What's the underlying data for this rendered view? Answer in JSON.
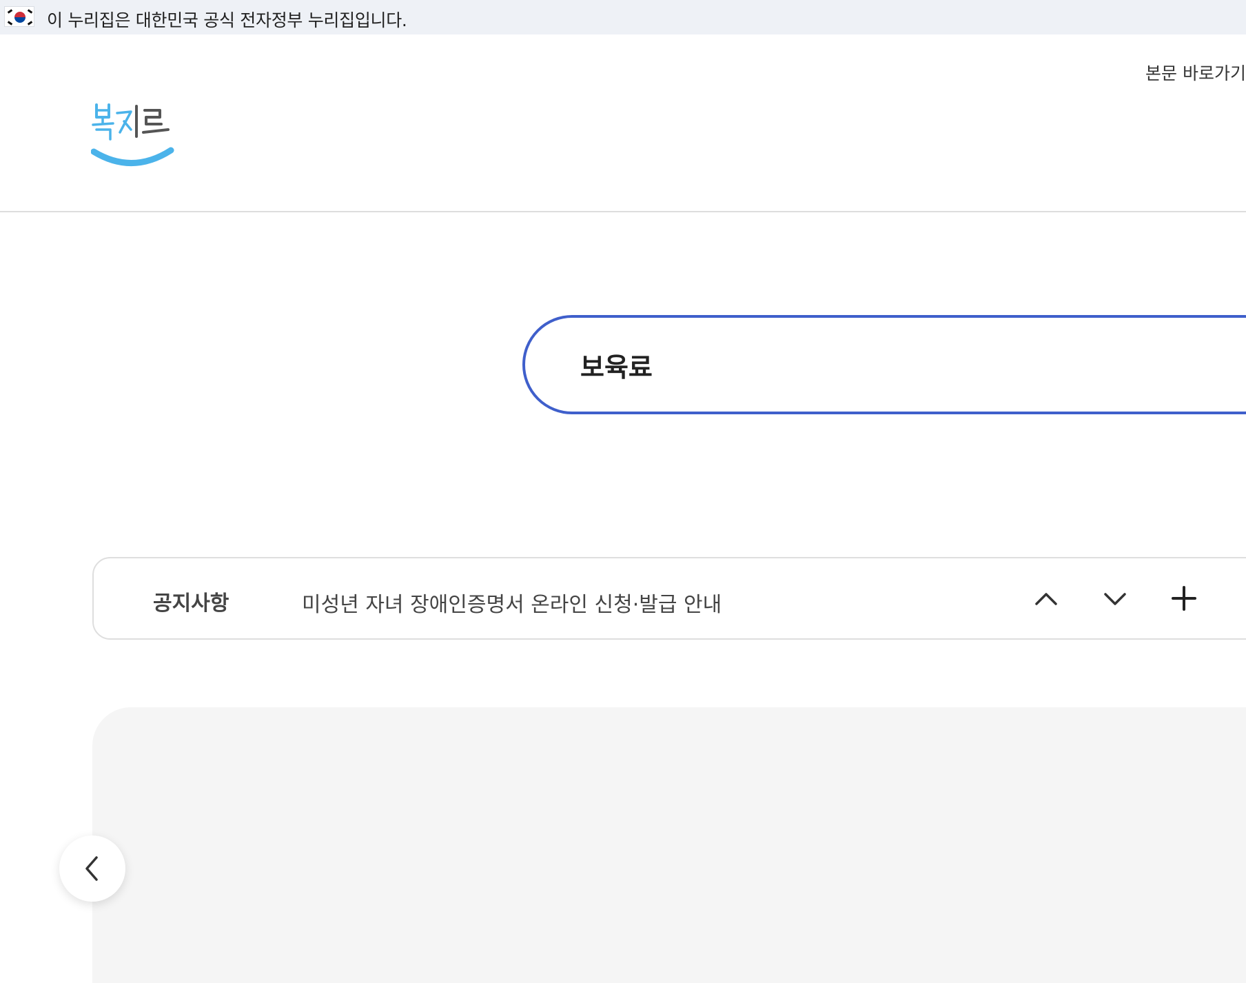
{
  "gov_banner": {
    "text": "이 누리집은 대한민국 공식 전자정부 누리집입니다."
  },
  "header": {
    "skip_link": "본문 바로가기",
    "logo_text": "복지로"
  },
  "search": {
    "value": "보육료"
  },
  "notice": {
    "label": "공지사항",
    "title": "미성년 자녀 장애인증명서 온라인 신청·발급 안내"
  },
  "colors": {
    "accent": "#3f5fcb",
    "logo_smile": "#4bb3ea",
    "logo_text": "#5a5a5a",
    "banner_bg": "#eef1f6",
    "slider_bg": "#f5f5f5"
  },
  "icons": {
    "flag": "korean-flag-icon",
    "notice_prev": "chevron-up-icon",
    "notice_next": "chevron-down-icon",
    "notice_more": "plus-icon",
    "slider_prev": "chevron-left-icon"
  }
}
